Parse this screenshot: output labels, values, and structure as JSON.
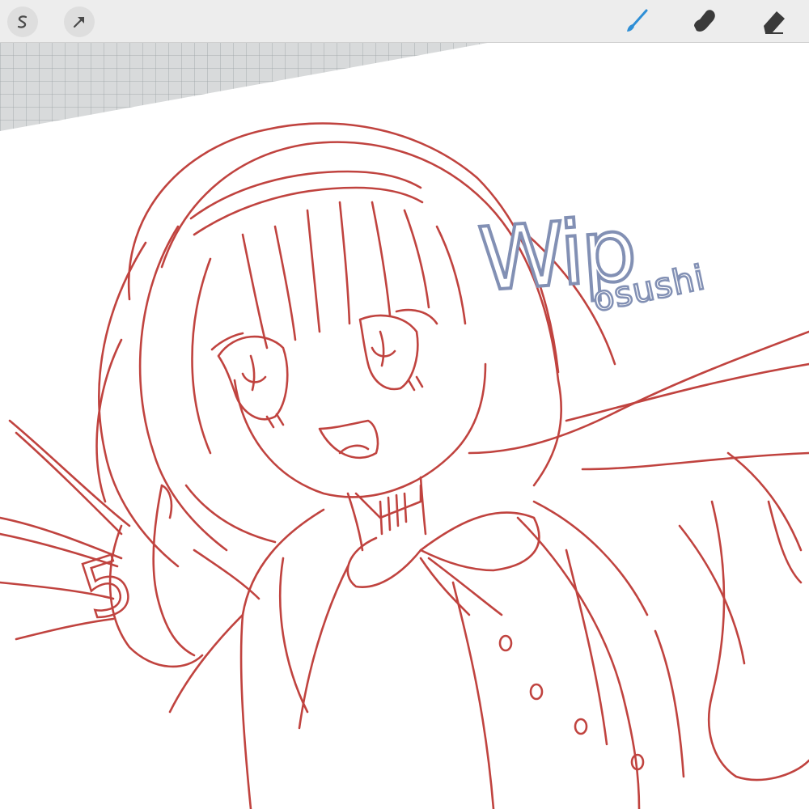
{
  "toolbar": {
    "left_buttons": [
      {
        "name": "selection",
        "icon": "selection-s-icon"
      },
      {
        "name": "transform",
        "icon": "arrow-cursor-icon"
      }
    ],
    "tools": [
      {
        "name": "brush",
        "icon": "brush-icon",
        "active": true
      },
      {
        "name": "smudge",
        "icon": "smudge-finger-icon",
        "active": false
      },
      {
        "name": "eraser",
        "icon": "eraser-icon",
        "active": false
      }
    ],
    "active_color": "#2f8fd6"
  },
  "canvas": {
    "stroke_color": "#c0433f",
    "watermark_color": "#8290b4",
    "title_text": "Wip",
    "author_text": "osushi",
    "hand_number": "5"
  }
}
